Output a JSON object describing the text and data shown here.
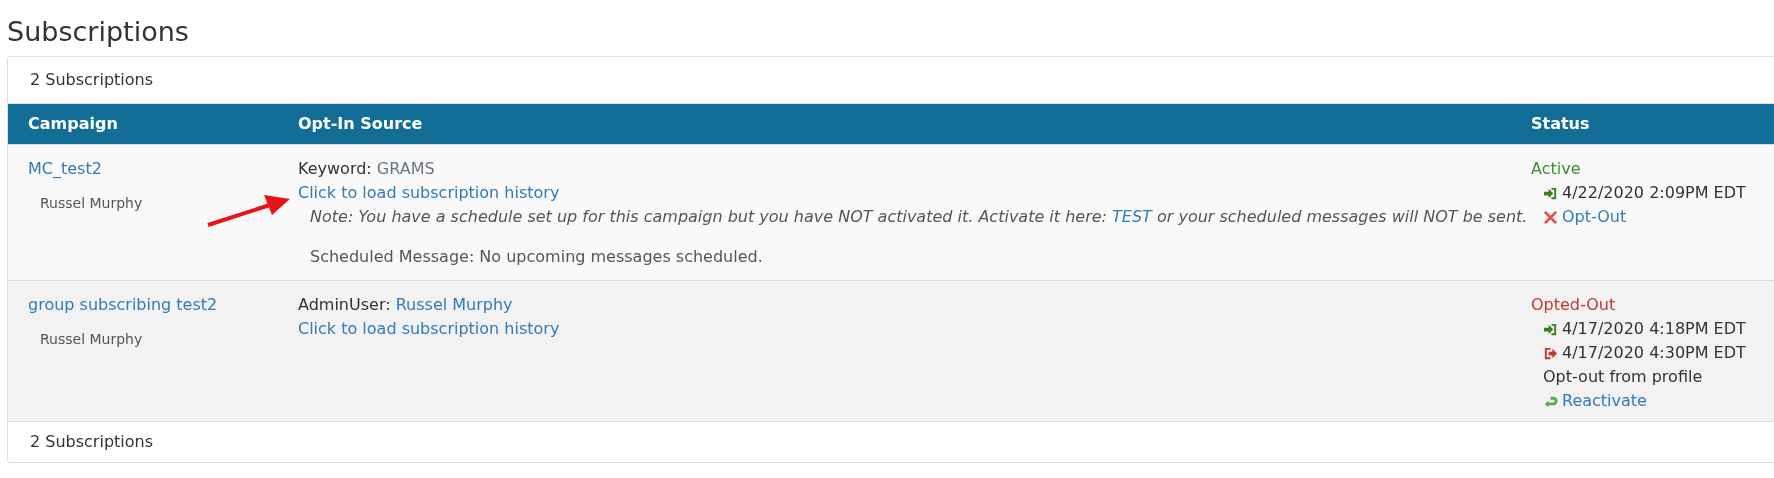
{
  "page_title": "Subscriptions",
  "card": {
    "header": "2 Subscriptions",
    "footer": "2 Subscriptions"
  },
  "table": {
    "columns": [
      "Campaign",
      "Opt-In Source",
      "Status"
    ],
    "rows": [
      {
        "campaign": "MC_test2",
        "owner": "Russel Murphy",
        "source_label": "Keyword:",
        "source_value": "GRAMS",
        "history_link": "Click to load subscription history",
        "note": "*Note: You have a schedule set up for this campaign but you have NOT activated it. Activate it here:*",
        "note_link": "TEST",
        "note_tail": "*or your scheduled messages will NOT be sent.*",
        "scheduled": "Scheduled Message: No upcoming messages scheduled.",
        "status": "Active",
        "color": "#3c8d2f",
        "events": [
          {
            "kind": "in",
            "text": "4/22/2020 2:09PM EDT"
          }
        ],
        "reason": null,
        "action": {
          "kind": "optout",
          "text": "Opt-Out"
        },
        "arrow": true
      },
      {
        "campaign": "group subscribing test2",
        "owner": "Russel Murphy",
        "source_label": "AdminUser:",
        "source_value": "Russel Murphy",
        "history_link": "Click to load subscription history",
        "status": "Opted-Out",
        "color": "#c0392b",
        "events": [
          {
            "kind": "in",
            "text": "4/17/2020 4:18PM EDT"
          },
          {
            "kind": "out",
            "text": "4/17/2020 4:30PM EDT"
          }
        ],
        "reason": "Opt-out from profile",
        "action": {
          "kind": "reactivate",
          "text": "Reactivate"
        },
        "arrow": false
      }
    ]
  }
}
